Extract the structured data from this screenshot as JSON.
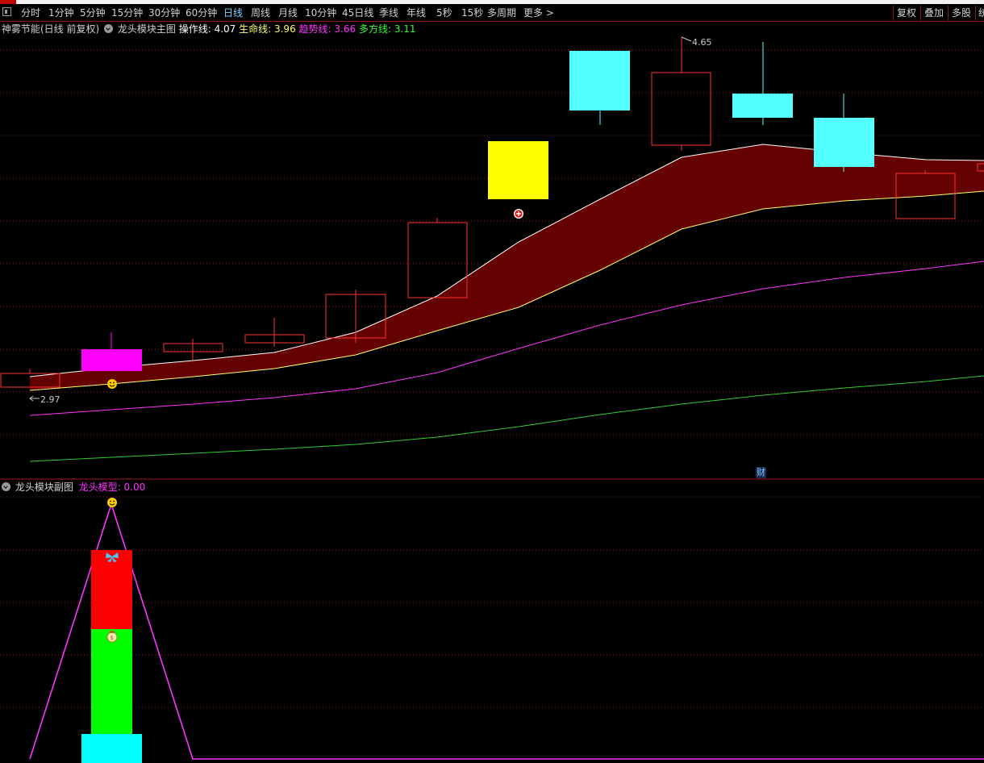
{
  "toolbar": {
    "periods": [
      {
        "label": "分时"
      },
      {
        "label": "1分钟"
      },
      {
        "label": "5分钟"
      },
      {
        "label": "15分钟"
      },
      {
        "label": "30分钟"
      },
      {
        "label": "60分钟"
      },
      {
        "label": "日线",
        "active": true
      },
      {
        "label": "周线"
      },
      {
        "label": "月线"
      },
      {
        "label": "10分钟"
      },
      {
        "label": "45日线"
      },
      {
        "label": "季线"
      },
      {
        "label": "年线"
      },
      {
        "label": "5秒"
      },
      {
        "label": "15秒"
      },
      {
        "label": "多周期"
      },
      {
        "label": "更多 >"
      }
    ],
    "right_buttons": [
      {
        "label": "复权"
      },
      {
        "label": "叠加"
      },
      {
        "label": "多股"
      },
      {
        "label": "统"
      }
    ]
  },
  "main_chart": {
    "stock_name": "神雾节能(日线 前复权)",
    "indicator_name": "龙头模块主图",
    "lines": [
      {
        "name": "操作线",
        "value": "4.07",
        "color": "#ffffff"
      },
      {
        "name": "生命线",
        "value": "3.96",
        "color": "#ffff66"
      },
      {
        "name": "趋势线",
        "value": "3.66",
        "color": "#ff33ff"
      },
      {
        "name": "多方线",
        "value": "3.11",
        "color": "#33ff33"
      }
    ],
    "high_label": "4.65",
    "low_label": "2.97",
    "finance_marker": "财"
  },
  "sub_chart": {
    "indicator_name": "龙头模块副图",
    "model_name": "龙头模型",
    "model_value": "0.00"
  },
  "colors": {
    "up_candle": "#ff3232",
    "down_candle": "#54ffff",
    "band_fill": "#650000",
    "grid": "#8a1a1a"
  }
}
